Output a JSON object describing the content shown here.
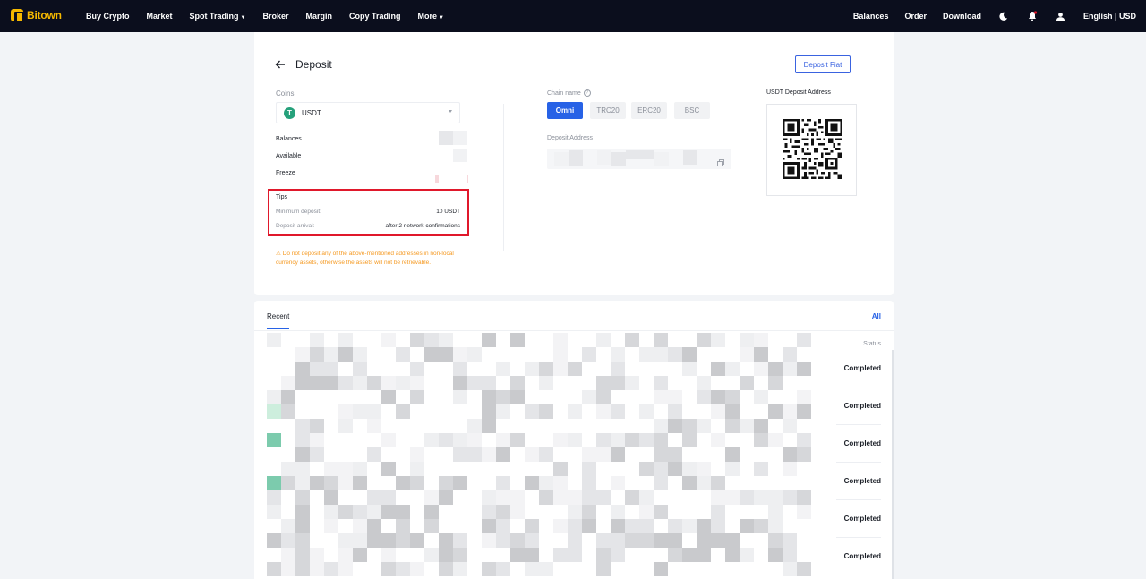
{
  "nav": {
    "logo": "Bitown",
    "left_items": [
      {
        "label": "Buy Crypto",
        "caret": false
      },
      {
        "label": "Market",
        "caret": false
      },
      {
        "label": "Spot Trading",
        "caret": true
      },
      {
        "label": "Broker",
        "caret": false
      },
      {
        "label": "Margin",
        "caret": false
      },
      {
        "label": "Copy Trading",
        "caret": false
      },
      {
        "label": "More",
        "caret": true
      }
    ],
    "balances": "Balances",
    "order": "Order",
    "download": "Download",
    "icons": [
      "moon-icon",
      "bell-icon",
      "user-icon"
    ],
    "language": "English | USD"
  },
  "deposit": {
    "title": "Deposit",
    "fiat_button": "Deposit Fiat",
    "coins_label": "Coins",
    "coin": {
      "symbol": "T",
      "name": "USDT",
      "icon_color": "#26a17b"
    },
    "balances_label": "Balances",
    "available_label": "Available",
    "freeze_label": "Freeze",
    "tips": {
      "title": "Tips",
      "min_label": "Minimum deposit:",
      "min_value": "10 USDT",
      "arrival_label": "Deposit arrival:",
      "arrival_value": "after 2 network confirmations"
    },
    "warning": "⚠ Do not deposit any of the above-mentioned addresses in non-local currency assets, otherwise the assets will not be retrievable.",
    "chain_label": "Chain name",
    "chains": [
      {
        "label": "Omni",
        "active": true
      },
      {
        "label": "TRC20",
        "active": false
      },
      {
        "label": "ERC20",
        "active": false
      },
      {
        "label": "BSC",
        "active": false
      }
    ],
    "address_label": "Deposit Address",
    "qr_label": "USDT Deposit Address"
  },
  "recent": {
    "tab": "Recent",
    "all_link": "All",
    "status_header": "Status",
    "rows": [
      {
        "status": "Completed"
      },
      {
        "status": "Completed"
      },
      {
        "status": "Completed"
      },
      {
        "status": "Completed"
      },
      {
        "status": "Completed"
      },
      {
        "status": "Completed"
      }
    ]
  },
  "colors": {
    "nav_bg": "#0b0e1d",
    "brand": "#f5b800",
    "accent": "#2762e6",
    "highlight_border": "#e0182b",
    "warning": "#f59a23"
  }
}
